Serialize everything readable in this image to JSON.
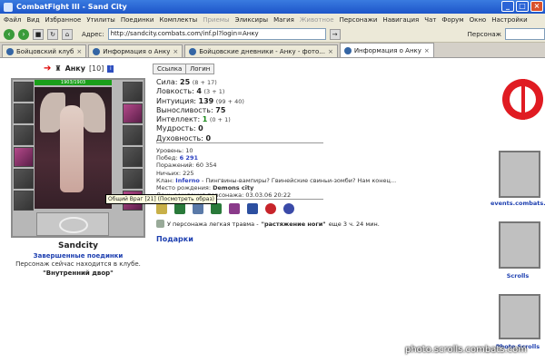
{
  "window": {
    "title": "CombatFight III - Sand City"
  },
  "menu": [
    "Файл",
    "Вид",
    "Избранное",
    "Утилиты",
    "Поединки",
    "Комплекты",
    "Приемы",
    "Эликсиры",
    "Магия",
    "Животное",
    "Персонажи",
    "Навигация",
    "Чат",
    "Форум",
    "Окно",
    "Настройки"
  ],
  "menu_disabled": [
    "Приемы",
    "Животное"
  ],
  "address": {
    "label": "Адрес:",
    "url": "http://sandcity.combats.com/inf.pl?login=Анку",
    "search_label": "Персонаж"
  },
  "tabs": [
    {
      "label": "Бойцовский клуб"
    },
    {
      "label": "Информация о Анку"
    },
    {
      "label": "Бойцовские дневники - Анку - фото..."
    },
    {
      "label": "Информация о Анку",
      "active": true
    }
  ],
  "character": {
    "name": "Анку",
    "level": "[10]",
    "hp": "1903/1903",
    "city_name": "Sandcity",
    "link_finished": "Завершенные поединки",
    "location_note": "Персонаж сейчас находится в клубе.",
    "location_place": "\"Внутренний двор\"",
    "tooltip": "Общий Враг [21] (Посмотреть образ)"
  },
  "buttons": {
    "link": "Ссылка",
    "login": "Логин"
  },
  "stats": [
    {
      "label": "Сила:",
      "value": "25",
      "bonus": "(8 + 17)"
    },
    {
      "label": "Ловкость:",
      "value": "4",
      "bonus": "(3 + 1)"
    },
    {
      "label": "Интуиция:",
      "value": "139",
      "bonus": "(99 + 40)"
    },
    {
      "label": "Выносливость:",
      "value": "75",
      "bonus": ""
    },
    {
      "label": "Интеллект:",
      "value": "1",
      "bonus": "(0 + 1)"
    },
    {
      "label": "Мудрость:",
      "value": "0",
      "bonus": ""
    },
    {
      "label": "Духовность:",
      "value": "0",
      "bonus": ""
    }
  ],
  "info": {
    "level": "Уровень: 10",
    "wins_label": "Побед:",
    "wins": "6 291",
    "losses": "Поражений: 60 354",
    "draws": "Ничьих: 225",
    "clan_label": "Клан:",
    "clan": "Inferno",
    "clan_desc": " - Пингвины-вампиры? Гвинейские свиньи-зомби? Нам конец...",
    "birthplace_label": "Место рождения:",
    "birthplace": "Demons city",
    "birthday": "День рождения персонажа: 03.03.06 20:22"
  },
  "injury": {
    "prefix": "У персонажа легкая травма -",
    "name": "\"растяжение ноги\"",
    "suffix": "еще 3 ч. 24 мин."
  },
  "gifts": "Подарки",
  "sidebar": {
    "events": "events.combats.com",
    "scrolls": "Scrolls",
    "photo": "Photo Scrolls"
  },
  "watermark": "photo.scrolls.combats.com",
  "colors": {
    "title_bar": "#1d55c9",
    "link_blue": "#1d3fb0",
    "hp_green": "#1a9f1a",
    "logo_red": "#e01b22"
  }
}
